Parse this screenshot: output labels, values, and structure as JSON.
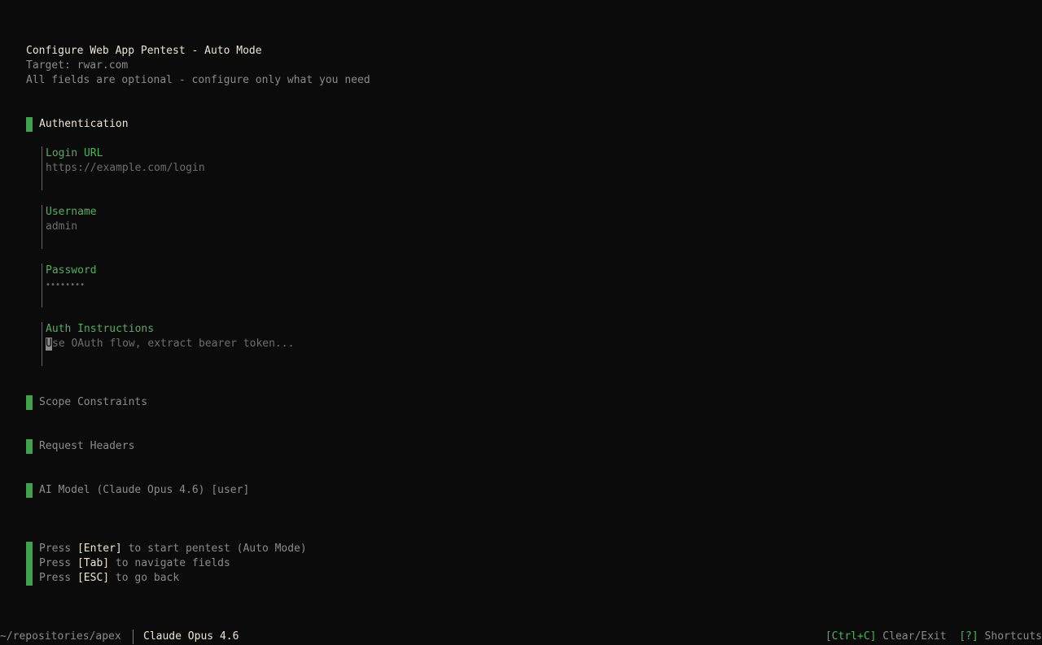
{
  "header": {
    "title": "Configure Web App Pentest - Auto Mode",
    "target": "Target: rwar.com",
    "subtitle": "All fields are optional - configure only what you need"
  },
  "sections": {
    "authentication": {
      "label": "Authentication",
      "fields": {
        "login_url": {
          "label": "Login URL",
          "placeholder": "https://example.com/login"
        },
        "username": {
          "label": "Username",
          "placeholder": "admin"
        },
        "password": {
          "label": "Password",
          "placeholder": "••••••••"
        },
        "auth_instructions": {
          "label": "Auth Instructions",
          "cursor_char": "U",
          "placeholder_rest": "se OAuth flow, extract bearer token..."
        }
      }
    },
    "scope": {
      "label": "Scope Constraints"
    },
    "headers": {
      "label": "Request Headers"
    },
    "model": {
      "label": "AI Model (Claude Opus 4.6) [user]"
    }
  },
  "help": {
    "press": "Press",
    "enter_key": "[Enter]",
    "enter_text": " to start pentest (Auto Mode)",
    "tab_key": "[Tab]",
    "tab_text": " to navigate fields",
    "esc_key": "[ESC]",
    "esc_text": " to go back"
  },
  "status_bar": {
    "path": "~/repositories/apex",
    "model": "Claude Opus 4.6",
    "ctrl_c_key": "[Ctrl+C]",
    "ctrl_c_text": " Clear/Exit",
    "shortcuts_key": "[?]",
    "shortcuts_text": " Shortcuts"
  },
  "colors": {
    "accent": "#3fa34d",
    "label_green": "#4fb35a",
    "title": "#ece6cf",
    "muted": "#8b8b8b",
    "background": "#0b0b0b"
  }
}
